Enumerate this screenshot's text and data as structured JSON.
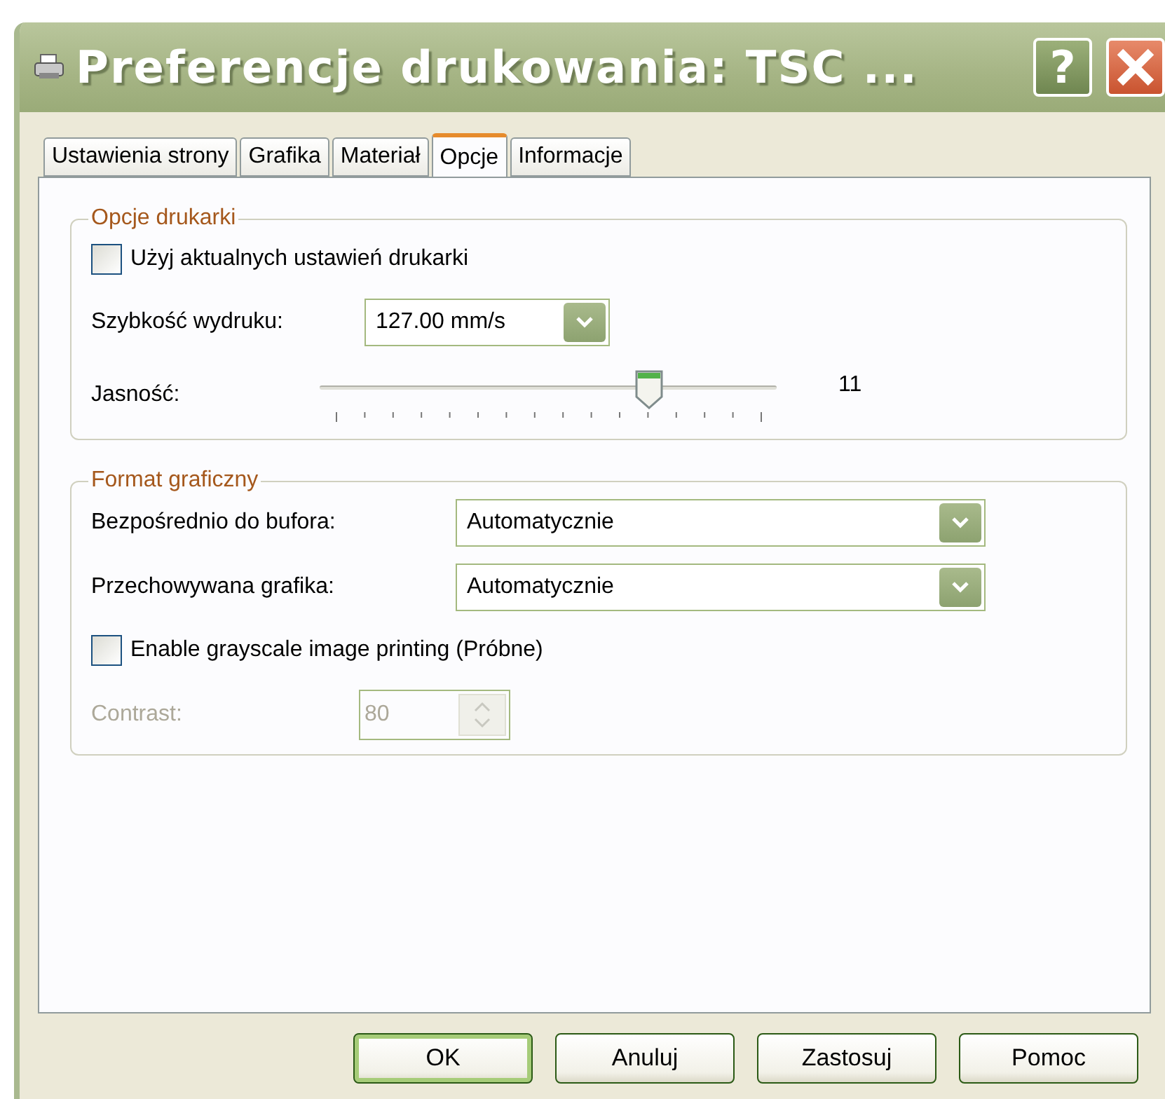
{
  "window": {
    "title": "Preferencje drukowania: TSC ...",
    "help": "?"
  },
  "tabs": [
    {
      "label": "Ustawienia strony",
      "selected": false
    },
    {
      "label": "Grafika",
      "selected": false
    },
    {
      "label": "Materiał",
      "selected": false
    },
    {
      "label": "Opcje",
      "selected": true
    },
    {
      "label": "Informacje",
      "selected": false
    }
  ],
  "groups": [
    {
      "title": "Opcje drukarki",
      "rows": [
        {
          "kind": "checkbox",
          "label": "Użyj aktualnych ustawień drukarki",
          "checked": false
        },
        {
          "kind": "select",
          "label": "Szybkość wydruku:",
          "value": "127.00 mm/s",
          "wide": false
        },
        {
          "kind": "slider",
          "label": "Jasność:",
          "level": 0.72,
          "reading": "11"
        }
      ]
    },
    {
      "title": "Format graficzny",
      "rows": [
        {
          "kind": "select",
          "label": "Bezpośrednio do bufora:",
          "value": "Automatycznie",
          "wide": true
        },
        {
          "kind": "select",
          "label": "Przechowywana grafika:",
          "value": "Automatycznie",
          "wide": true
        },
        {
          "kind": "checkbox",
          "label": "Enable grayscale image printing (Próbne)",
          "checked": false
        },
        {
          "kind": "spin",
          "label": "Contrast:",
          "value": "80",
          "disabled": true
        }
      ]
    }
  ],
  "buttons": [
    {
      "label": "OK",
      "default": true
    },
    {
      "label": "Anuluj",
      "default": false
    },
    {
      "label": "Zastosuj",
      "default": false
    },
    {
      "label": "Pomoc",
      "default": false
    }
  ]
}
